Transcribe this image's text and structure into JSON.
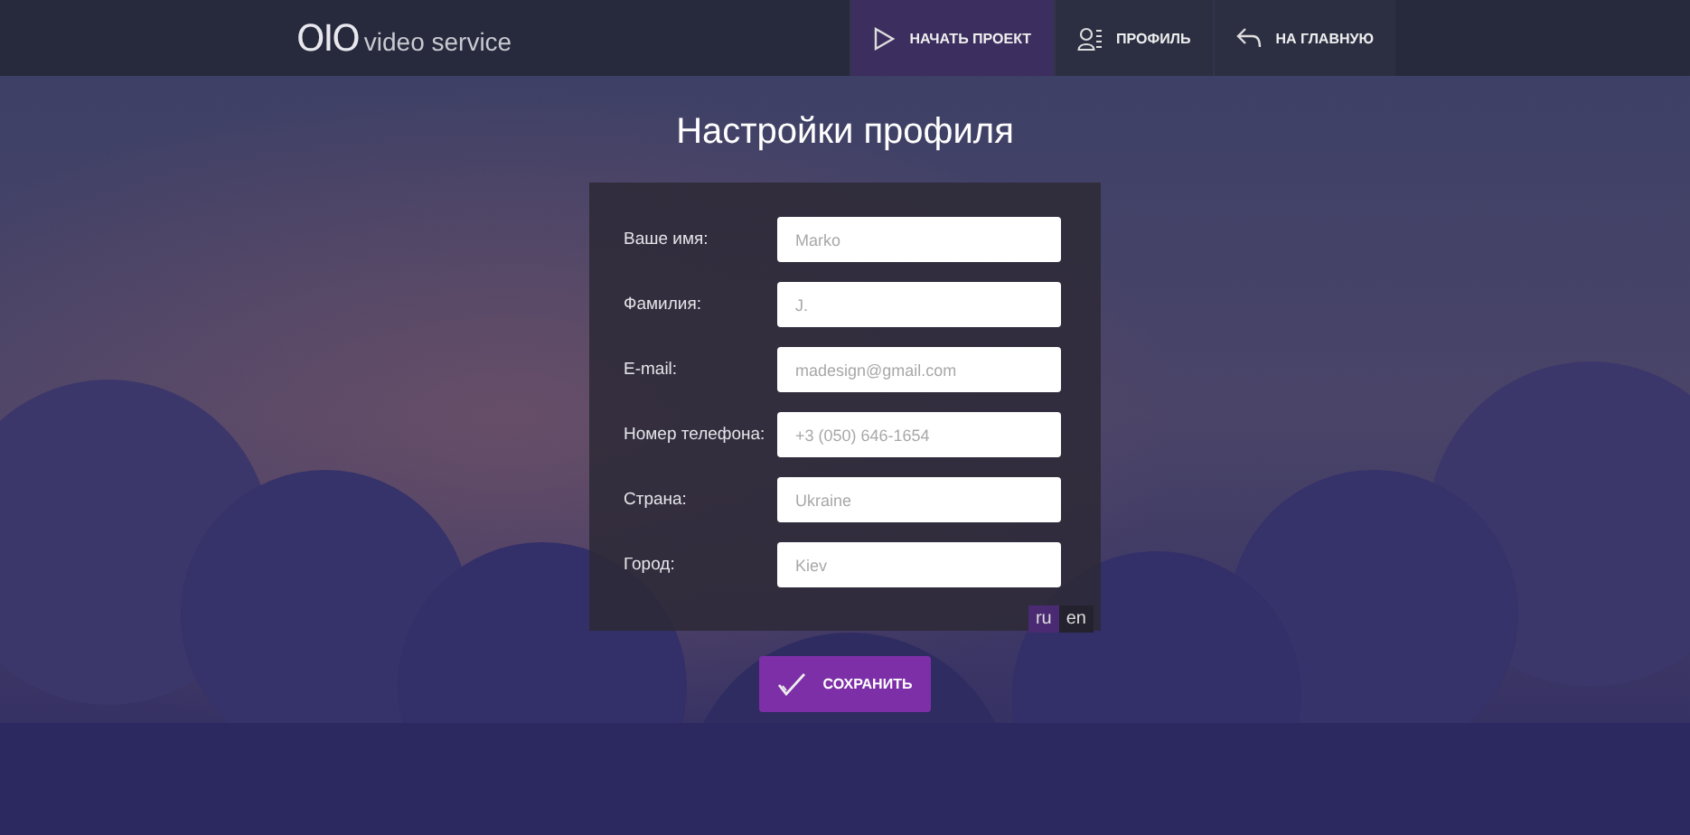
{
  "header": {
    "logo_mark": "OIO",
    "logo_text": "video service",
    "nav": [
      {
        "label": "НАЧАТЬ ПРОЕКТ",
        "kind": "play",
        "selected": true
      },
      {
        "label": "ПРОФИЛЬ",
        "kind": "profile",
        "selected": false
      },
      {
        "label": "НА ГЛАВНУЮ",
        "kind": "back",
        "selected": false
      }
    ]
  },
  "title": "Настройки профиля",
  "fields": [
    {
      "label": "Ваше имя:",
      "placeholder": "Marko"
    },
    {
      "label": "Фамилия:",
      "placeholder": "J."
    },
    {
      "label": "E-mail:",
      "placeholder": "madesign@gmail.com"
    },
    {
      "label": "Номер телефона:",
      "placeholder": "+3 (050) 646-1654"
    },
    {
      "label": "Страна:",
      "placeholder": "Ukraine"
    },
    {
      "label": "Город:",
      "placeholder": "Kiev"
    }
  ],
  "languages": [
    {
      "label": "ru",
      "selected": true
    },
    {
      "label": "en",
      "selected": false
    }
  ],
  "save_button": "СОХРАНИТЬ"
}
